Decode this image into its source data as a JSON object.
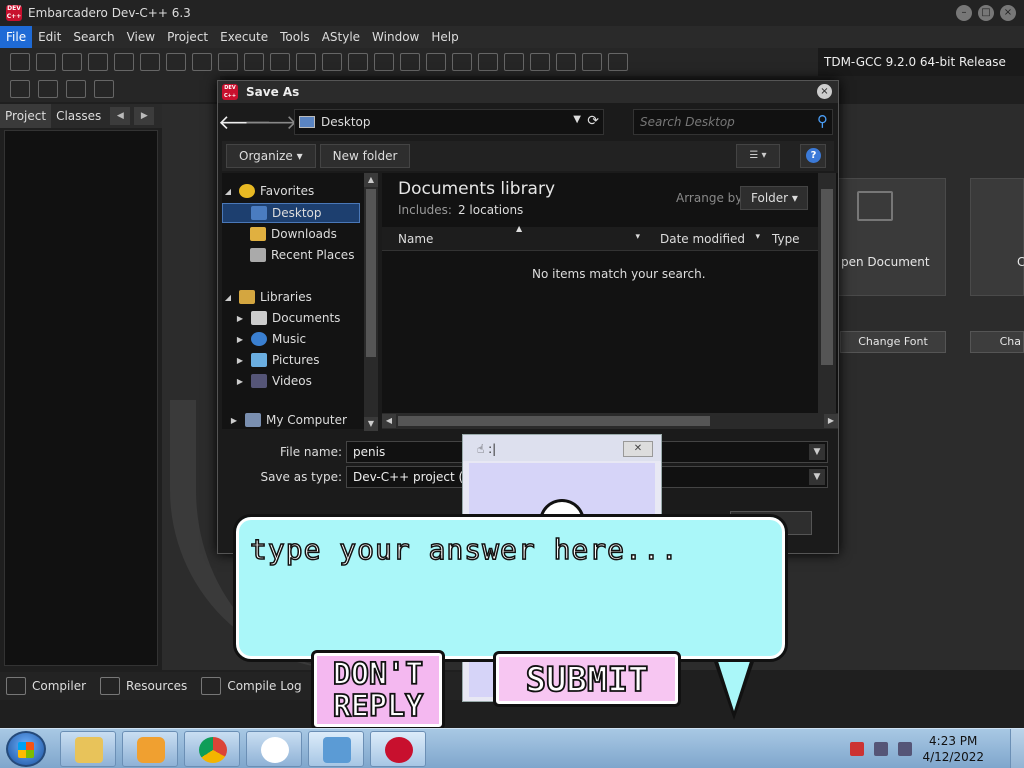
{
  "app": {
    "title": "Embarcadero Dev-C++ 6.3",
    "logo_text": "DEV C++",
    "compiler": "TDM-GCC 9.2.0 64-bit Release"
  },
  "menu": [
    "File",
    "Edit",
    "Search",
    "View",
    "Project",
    "Execute",
    "Tools",
    "AStyle",
    "Window",
    "Help"
  ],
  "left_tabs": {
    "project": "Project",
    "classes": "Classes"
  },
  "bottom_tabs": [
    "Compiler",
    "Resources",
    "Compile Log"
  ],
  "welcome": {
    "open_document": "pen Document",
    "change_font": "Change Font",
    "cha": "Cha",
    "c_edge": "C"
  },
  "dialog": {
    "title": "Save As",
    "address": "Desktop",
    "search_placeholder": "Search Desktop",
    "organize": "Organize",
    "new_folder": "New folder",
    "nav": {
      "favorites": "Favorites",
      "desktop": "Desktop",
      "downloads": "Downloads",
      "recent_places": "Recent Places",
      "libraries": "Libraries",
      "documents": "Documents",
      "music": "Music",
      "pictures": "Pictures",
      "videos": "Videos",
      "my_computer": "My Computer"
    },
    "library_title": "Documents library",
    "includes_label": "Includes:",
    "includes_value": "2 locations",
    "arrange_by": "Arrange by:",
    "arrange_value": "Folder",
    "columns": {
      "name": "Name",
      "date": "Date modified",
      "type": "Type"
    },
    "empty_message": "No items match your search.",
    "file_name_label": "File name:",
    "file_name_value": "penis",
    "save_type_label": "Save as type:",
    "save_type_value": "Dev-C++ project (*.dev"
  },
  "popup": {
    "title": ":|"
  },
  "bubble": {
    "placeholder": "type your answer here...",
    "dont_reply": "DON'T\nREPLY",
    "submit": "SUBMIT"
  },
  "taskbar": {
    "time": "4:23 PM",
    "date": "4/12/2022"
  }
}
